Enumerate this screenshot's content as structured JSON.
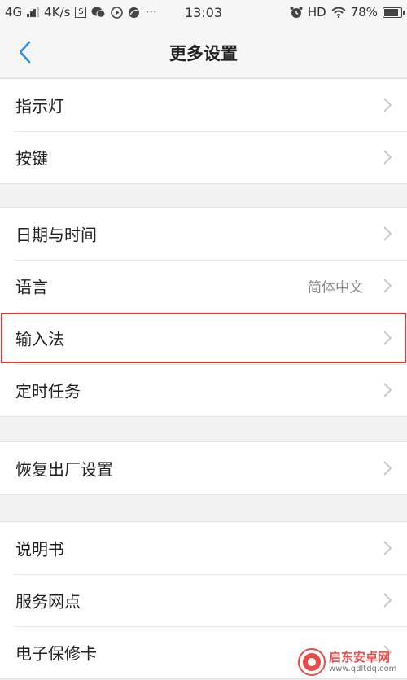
{
  "status_bar": {
    "network": "4G",
    "speed": "4K/s",
    "sim_badge": "S",
    "dots": "···",
    "time": "13:03",
    "hd": "HD",
    "battery_percent": "78%",
    "battery_level": 0.78
  },
  "header": {
    "title": "更多设置"
  },
  "groups": [
    {
      "items": [
        {
          "label": "指示灯"
        },
        {
          "label": "按键"
        }
      ]
    },
    {
      "items": [
        {
          "label": "日期与时间"
        },
        {
          "label": "语言",
          "value": "简体中文"
        },
        {
          "label": "输入法",
          "highlighted": true
        },
        {
          "label": "定时任务"
        }
      ]
    },
    {
      "items": [
        {
          "label": "恢复出厂设置"
        }
      ]
    },
    {
      "items": [
        {
          "label": "说明书"
        },
        {
          "label": "服务网点"
        },
        {
          "label": "电子保修卡"
        }
      ]
    }
  ],
  "watermark": {
    "name": "启东安卓网",
    "url": "www.qdltdq.com"
  },
  "colors": {
    "highlight": "#e53935",
    "accent": "#2a8ee8"
  },
  "icons": [
    "back-icon",
    "chevron-right-icon",
    "wifi-icon",
    "alarm-icon",
    "wechat-icon",
    "play-icon",
    "leaf-icon",
    "battery-icon"
  ]
}
